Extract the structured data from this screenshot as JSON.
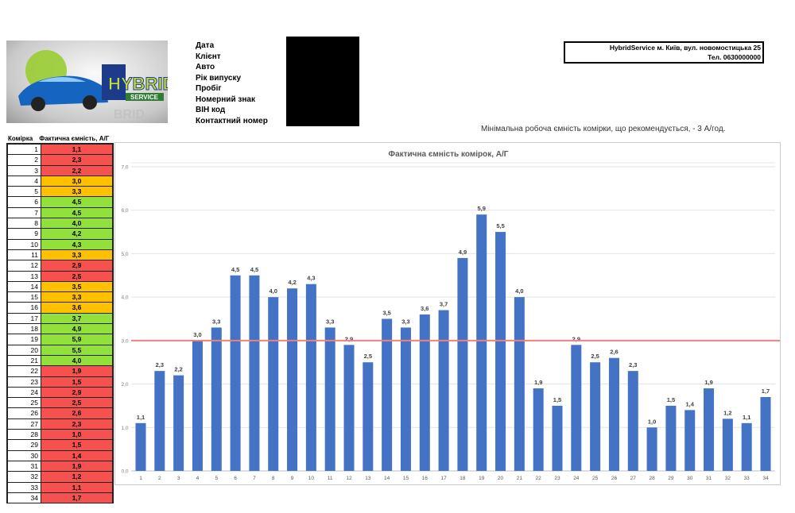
{
  "logo": {
    "text": "HYBRID SERVICE"
  },
  "info_labels": [
    "Дата",
    "Клієнт",
    "Авто",
    "Рік випуску",
    "Пробіг",
    "Номерний знак",
    "ВІН код",
    "Контактний номер"
  ],
  "address": {
    "line1": "HybridService м. Київ, вул. новомостицька 25",
    "line2": "Тел. 0630000000"
  },
  "min_note": "Мінімальна робоча ємність комірки, що рекомендується, - 3 А/год.",
  "table": {
    "headers": [
      "Комірка",
      "Фактична ємність, А/Г"
    ],
    "status_colors": {
      "red": "#f4514f",
      "orange": "#ffc000",
      "green": "#92e03c"
    },
    "rows": [
      {
        "cell": "1",
        "value": "1,1",
        "status": "red"
      },
      {
        "cell": "2",
        "value": "2,3",
        "status": "red"
      },
      {
        "cell": "3",
        "value": "2,2",
        "status": "red"
      },
      {
        "cell": "4",
        "value": "3,0",
        "status": "orange"
      },
      {
        "cell": "5",
        "value": "3,3",
        "status": "orange"
      },
      {
        "cell": "6",
        "value": "4,5",
        "status": "green"
      },
      {
        "cell": "7",
        "value": "4,5",
        "status": "green"
      },
      {
        "cell": "8",
        "value": "4,0",
        "status": "green"
      },
      {
        "cell": "9",
        "value": "4,2",
        "status": "green"
      },
      {
        "cell": "10",
        "value": "4,3",
        "status": "green"
      },
      {
        "cell": "11",
        "value": "3,3",
        "status": "orange"
      },
      {
        "cell": "12",
        "value": "2,9",
        "status": "red"
      },
      {
        "cell": "13",
        "value": "2,5",
        "status": "red"
      },
      {
        "cell": "14",
        "value": "3,5",
        "status": "orange"
      },
      {
        "cell": "15",
        "value": "3,3",
        "status": "orange"
      },
      {
        "cell": "16",
        "value": "3,6",
        "status": "orange"
      },
      {
        "cell": "17",
        "value": "3,7",
        "status": "green"
      },
      {
        "cell": "18",
        "value": "4,9",
        "status": "green"
      },
      {
        "cell": "19",
        "value": "5,9",
        "status": "green"
      },
      {
        "cell": "20",
        "value": "5,5",
        "status": "green"
      },
      {
        "cell": "21",
        "value": "4,0",
        "status": "green"
      },
      {
        "cell": "22",
        "value": "1,9",
        "status": "red"
      },
      {
        "cell": "23",
        "value": "1,5",
        "status": "red"
      },
      {
        "cell": "24",
        "value": "2,9",
        "status": "red"
      },
      {
        "cell": "25",
        "value": "2,5",
        "status": "red"
      },
      {
        "cell": "26",
        "value": "2,6",
        "status": "red"
      },
      {
        "cell": "27",
        "value": "2,3",
        "status": "red"
      },
      {
        "cell": "28",
        "value": "1,0",
        "status": "red"
      },
      {
        "cell": "29",
        "value": "1,5",
        "status": "red"
      },
      {
        "cell": "30",
        "value": "1,4",
        "status": "red"
      },
      {
        "cell": "31",
        "value": "1,9",
        "status": "red"
      },
      {
        "cell": "32",
        "value": "1,2",
        "status": "red"
      },
      {
        "cell": "33",
        "value": "1,1",
        "status": "red"
      },
      {
        "cell": "34",
        "value": "1,7",
        "status": "red"
      }
    ]
  },
  "chart_data": {
    "type": "bar",
    "title": "Фактична ємність комірок, А/Г",
    "categories": [
      "1",
      "2",
      "3",
      "4",
      "5",
      "6",
      "7",
      "8",
      "9",
      "10",
      "11",
      "12",
      "13",
      "14",
      "15",
      "16",
      "17",
      "18",
      "19",
      "20",
      "21",
      "22",
      "23",
      "24",
      "25",
      "26",
      "27",
      "28",
      "29",
      "30",
      "31",
      "32",
      "33",
      "34"
    ],
    "values": [
      1.1,
      2.3,
      2.2,
      3.0,
      3.3,
      4.5,
      4.5,
      4.0,
      4.2,
      4.3,
      3.3,
      2.9,
      2.5,
      3.5,
      3.3,
      3.6,
      3.7,
      4.9,
      5.9,
      5.5,
      4.0,
      1.9,
      1.5,
      2.9,
      2.5,
      2.6,
      2.3,
      1.0,
      1.5,
      1.4,
      1.9,
      1.2,
      1.1,
      1.7
    ],
    "ylim": [
      0,
      7
    ],
    "yticks": [
      "0,0",
      "1,0",
      "2,0",
      "3,0",
      "4,0",
      "5,0",
      "6,0",
      "7,0"
    ],
    "grid": true,
    "reference_line": {
      "value": 3.0,
      "color": "#f08080"
    },
    "bar_color": "#4472c4",
    "data_labels": true
  }
}
